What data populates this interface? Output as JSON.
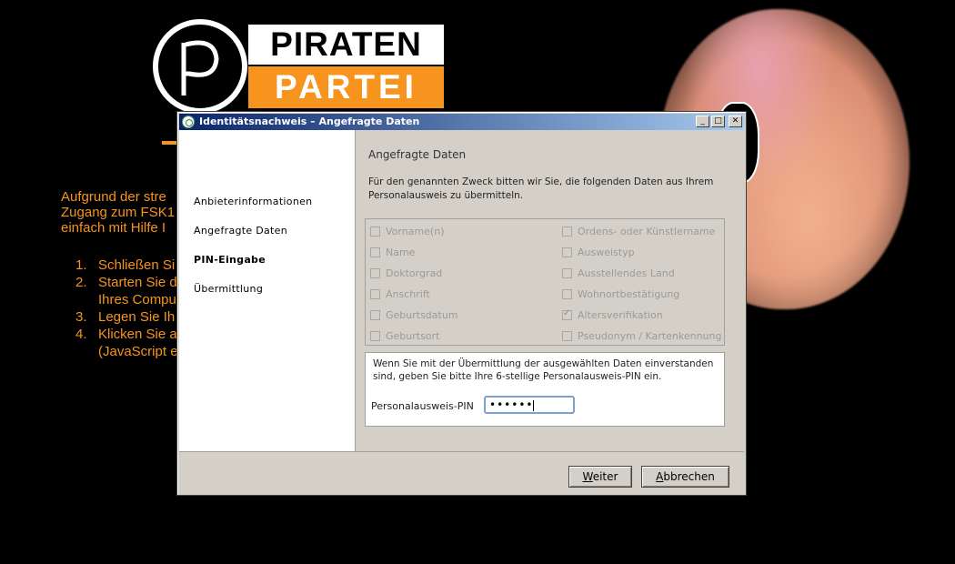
{
  "background": {
    "logo": {
      "top": "PIRATEN",
      "bottom": "PARTEI"
    },
    "intro_lines": [
      "Aufgrund der stre",
      "Zugang zum FSK1",
      "einfach mit Hilfe I"
    ],
    "list": [
      {
        "num": "1.",
        "lines": [
          "Schließen Si"
        ]
      },
      {
        "num": "2.",
        "lines": [
          "Starten Sie d",
          "Ihres Compu"
        ]
      },
      {
        "num": "3.",
        "lines": [
          "Legen Sie Ih"
        ]
      },
      {
        "num": "4.",
        "lines": [
          "Klicken Sie a",
          "(JavaScript e"
        ]
      }
    ]
  },
  "dialog": {
    "title": "Identitätsnachweis – Angefragte Daten",
    "window_buttons": {
      "minimize": "_",
      "maximize": "□",
      "close": "✕"
    },
    "nav": [
      {
        "label": "Anbieterinformationen",
        "active": false
      },
      {
        "label": "Angefragte Daten",
        "active": false
      },
      {
        "label": "PIN-Eingabe",
        "active": true
      },
      {
        "label": "Übermittlung",
        "active": false
      }
    ],
    "section_title": "Angefragte Daten",
    "intro": "Für den genannten Zweck bitten wir Sie, die folgenden Daten aus Ihrem Personalausweis zu übermitteln.",
    "fields_left": [
      {
        "label": "Vorname(n)",
        "checked": false
      },
      {
        "label": "Name",
        "checked": false
      },
      {
        "label": "Doktorgrad",
        "checked": false
      },
      {
        "label": "Anschrift",
        "checked": false
      },
      {
        "label": "Geburtsdatum",
        "checked": false
      },
      {
        "label": "Geburtsort",
        "checked": false
      }
    ],
    "fields_right": [
      {
        "label": "Ordens- oder Künstlername",
        "checked": false
      },
      {
        "label": "Ausweistyp",
        "checked": false
      },
      {
        "label": "Ausstellendes Land",
        "checked": false
      },
      {
        "label": "Wohnortbestätigung",
        "checked": false
      },
      {
        "label": "Altersverifikation",
        "checked": true
      },
      {
        "label": "Pseudonym / Kartenkennung",
        "checked": false
      }
    ],
    "pin_info": "Wenn Sie mit der Übermittlung der ausgewählten Daten einverstanden sind, geben Sie bitte Ihre 6-stellige Personalausweis-PIN ein.",
    "pin_label": "Personalausweis-PIN",
    "pin_value": "••••••",
    "buttons": {
      "next": {
        "mnemonic": "W",
        "rest": "eiter"
      },
      "cancel": {
        "mnemonic": "A",
        "rest": "bbrechen"
      }
    }
  },
  "colors": {
    "accent": "#f7941d",
    "titlebar_start": "#0a246a",
    "titlebar_end": "#a6caf0",
    "dialog_bg": "#d4d0c8"
  }
}
